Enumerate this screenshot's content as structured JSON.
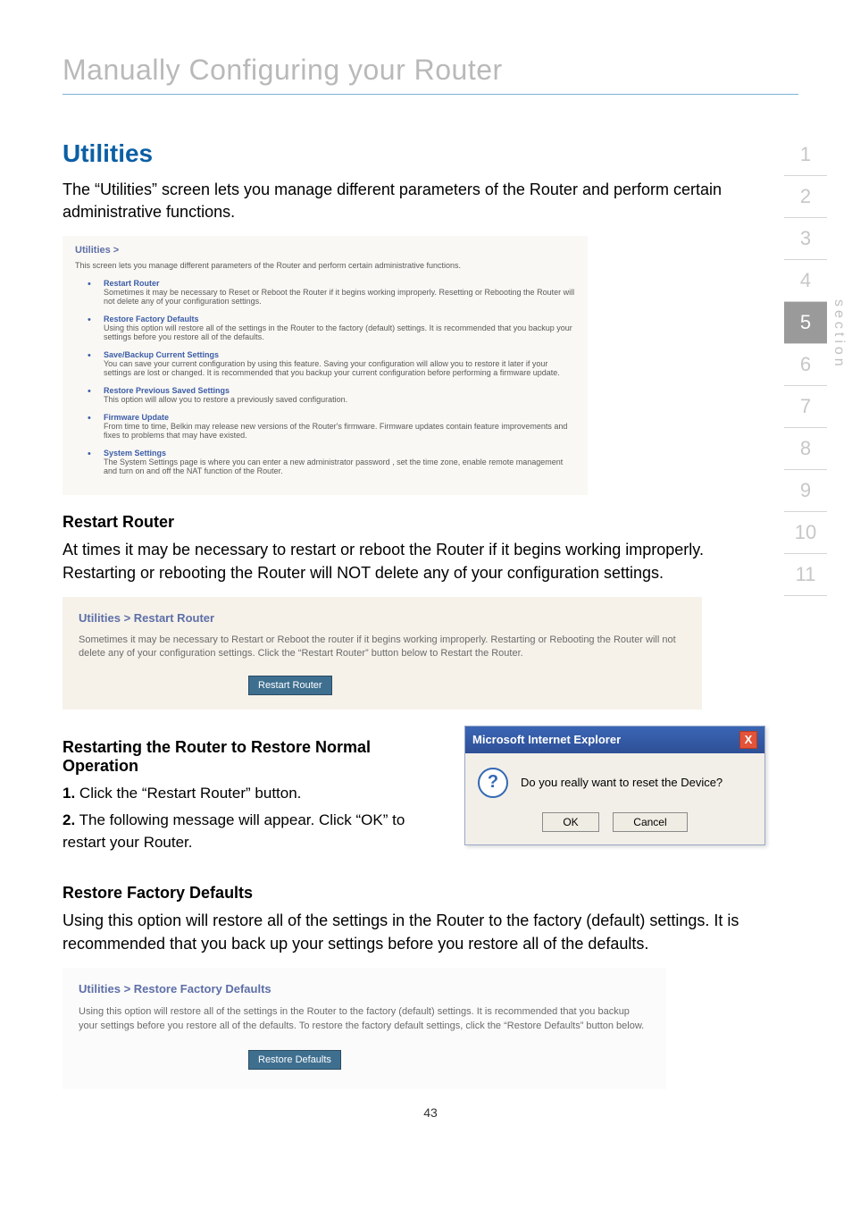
{
  "page_title": "Manually Configuring your Router",
  "section_nav": {
    "items": [
      "1",
      "2",
      "3",
      "4",
      "5",
      "6",
      "7",
      "8",
      "9",
      "10",
      "11"
    ],
    "active_index": 4,
    "label": "section"
  },
  "h2_utilities": "Utilities",
  "utilities_intro": "The “Utilities” screen lets you manage different parameters of the Router and perform certain administrative functions.",
  "shot1": {
    "header": "Utilities >",
    "intro": "This screen lets you manage different parameters of the Router and perform certain administrative functions.",
    "items": [
      {
        "title": "Restart Router",
        "desc": "Sometimes it may be necessary to Reset or Reboot the Router if it begins working improperly. Resetting or Rebooting the Router will not delete any of your configuration settings."
      },
      {
        "title": "Restore Factory Defaults",
        "desc": "Using this option will restore all of the settings in the Router to the factory (default) settings. It is recommended that you backup your settings before you restore all of the defaults."
      },
      {
        "title": "Save/Backup Current Settings",
        "desc": "You can save your current configuration by using this feature. Saving your configuration will allow you to restore it later if your settings are lost or changed. It is recommended that you backup your current configuration before performing a firmware update."
      },
      {
        "title": "Restore Previous Saved Settings",
        "desc": "This option will allow you to restore a previously saved configuration."
      },
      {
        "title": "Firmware Update",
        "desc": "From time to time, Belkin may release new versions of the Router's firmware. Firmware updates contain feature improvements and fixes to problems that may have existed."
      },
      {
        "title": "System Settings",
        "desc": "The System Settings page is where you can enter a new administrator password , set the time zone, enable remote management and turn on and off the NAT function of the Router."
      }
    ]
  },
  "restart_heading": "Restart Router",
  "restart_body": "At times it may be necessary to restart or reboot the Router if it begins working improperly. Restarting or rebooting the Router will NOT delete any of your configuration settings.",
  "shot2": {
    "header": "Utilities > Restart Router",
    "desc": "Sometimes it may be necessary to Restart or Reboot the router if it begins working improperly. Restarting or Rebooting the Router will not delete any of your configuration settings. Click the “Restart Router” button below to Restart the Router.",
    "button": "Restart Router"
  },
  "restore_normal_heading": "Restarting the Router to Restore Normal Operation",
  "steps": [
    {
      "num": "1.",
      "text": " Click the “Restart Router” button."
    },
    {
      "num": "2.",
      "text": " The following message will appear. Click “OK” to restart your Router."
    }
  ],
  "dialog": {
    "title": "Microsoft Internet Explorer",
    "close": "X",
    "qmark": "?",
    "message": "Do you really want to reset the Device?",
    "ok": "OK",
    "cancel": "Cancel"
  },
  "restore_defaults_heading": "Restore Factory Defaults",
  "restore_defaults_body": "Using this option will restore all of the settings in the Router to the factory (default) settings. It is recommended that you back up your settings before you restore all of the defaults.",
  "shot3": {
    "header": "Utilities > Restore Factory Defaults",
    "desc": "Using this option will restore all of the settings in the Router to the factory (default) settings. It is recommended that you backup your settings before you restore all of the defaults. To restore the factory default settings, click the “Restore Defaults” button below.",
    "button": "Restore Defaults"
  },
  "page_number": "43"
}
